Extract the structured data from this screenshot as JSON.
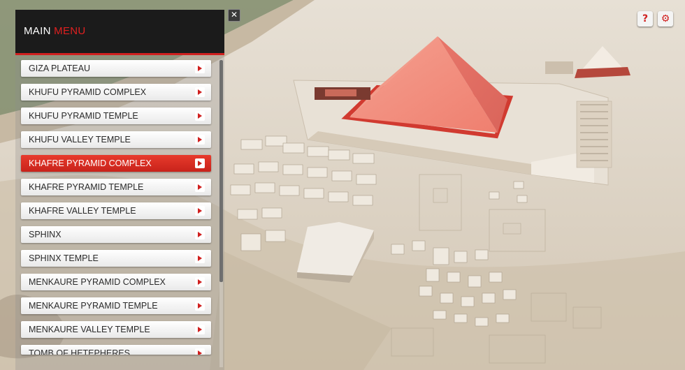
{
  "menu": {
    "title_main": "MAIN",
    "title_accent": "MENU",
    "items": [
      {
        "label": "GIZA PLATEAU"
      },
      {
        "label": "KHUFU PYRAMID COMPLEX"
      },
      {
        "label": "KHUFU PYRAMID TEMPLE"
      },
      {
        "label": "KHUFU VALLEY TEMPLE"
      },
      {
        "label": "KHAFRE PYRAMID COMPLEX"
      },
      {
        "label": "KHAFRE PYRAMID TEMPLE"
      },
      {
        "label": "KHAFRE VALLEY TEMPLE"
      },
      {
        "label": "SPHINX"
      },
      {
        "label": "SPHINX TEMPLE"
      },
      {
        "label": "MENKAURE PYRAMID COMPLEX"
      },
      {
        "label": "MENKAURE PYRAMID TEMPLE"
      },
      {
        "label": "MENKAURE VALLEY TEMPLE"
      },
      {
        "label": "TOMB OF HETEPHERES"
      }
    ],
    "active_index": 4
  },
  "buttons": {
    "close_glyph": "✕",
    "help_glyph": "?",
    "settings_glyph": "⚙"
  },
  "colors": {
    "accent": "#d0201f",
    "highlight_pyramid": "#f08070",
    "sand": "#d8cebf"
  }
}
